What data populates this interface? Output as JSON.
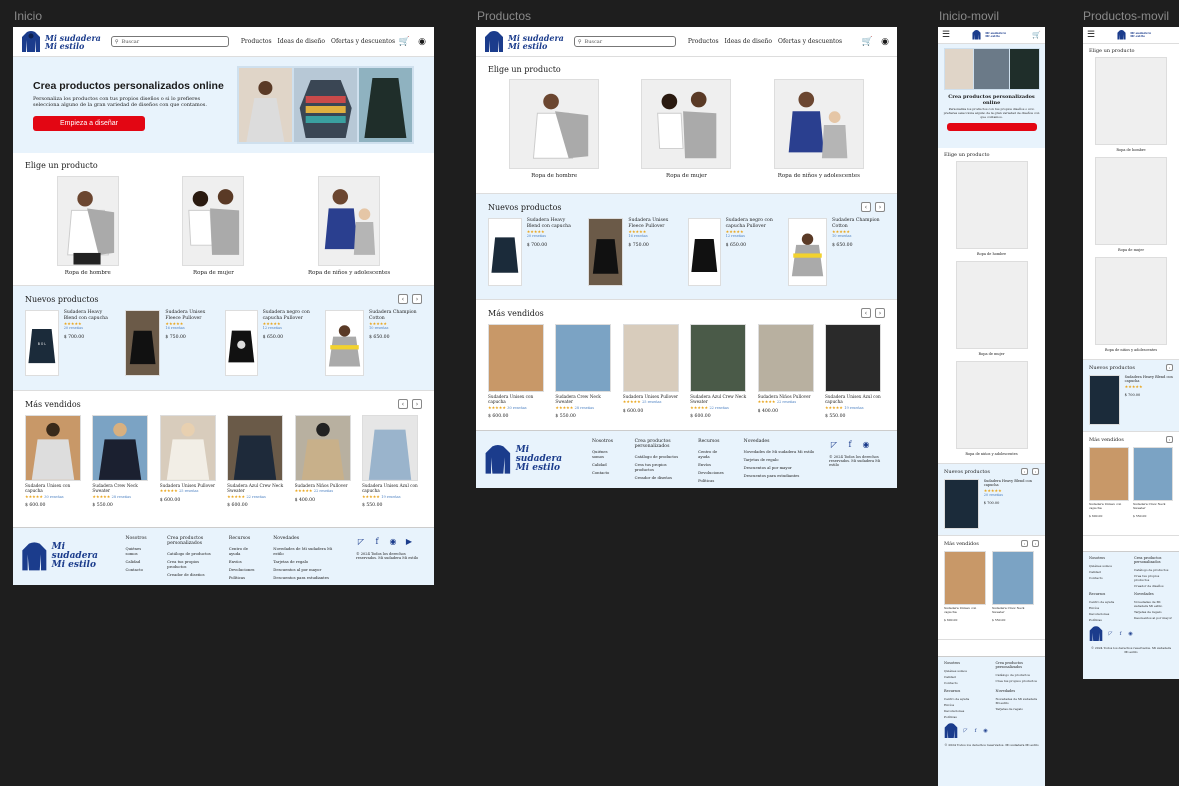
{
  "frames": {
    "inicio": "Inicio",
    "productos": "Productos",
    "inicio_movil": "Inicio-movil",
    "productos_movil": "Productos-movil"
  },
  "brand": {
    "line1": "Mi sudadera",
    "line2": "Mi estilo"
  },
  "search": {
    "placeholder": "Buscar"
  },
  "nav": [
    "Productos",
    "Ideas de diseño",
    "Ofertas y descuentos"
  ],
  "hero": {
    "title": "Crea productos personalizados online",
    "text": "Personaliza los productos con tus propios diseños o si lo prefieres selecciona alguno de la gran variedad de diseños con que contamos.",
    "button": "Empieza a diseñar"
  },
  "elige": {
    "title": "Elige un producto",
    "items": [
      "Ropa de hombre",
      "Ropa de mujer",
      "Ropa de niños y adolescentes"
    ]
  },
  "nuevos": {
    "title": "Nuevos productos",
    "items": [
      {
        "name": "Sudadera Heavy Blend con capucha",
        "reviews": "20 reseñas",
        "price": "$ 700.00"
      },
      {
        "name": "Sudadera Unisex Fleece Pullover",
        "reviews": "16 reseñas",
        "price": "$ 750.00"
      },
      {
        "name": "Sudadera negro con capucha Pullover",
        "reviews": "12 reseñas",
        "price": "$ 650.00"
      },
      {
        "name": "Sudadera Champion Cotton",
        "reviews": "10 reseñas",
        "price": "$ 650.00"
      }
    ]
  },
  "vendidos": {
    "title": "Más vendidos",
    "items": [
      {
        "name": "Sudadera Unisex con capucha",
        "reviews": "30 reseñas",
        "price": "$ 600.00"
      },
      {
        "name": "Sudadera Crew Neck Sweater",
        "reviews": "28 reseñas",
        "price": "$ 550.00"
      },
      {
        "name": "Sudadera Unisex Pullover",
        "reviews": "25 reseñas",
        "price": "$ 600.00"
      },
      {
        "name": "Sudadera Azul Crew Neck Sweater",
        "reviews": "22 reseñas",
        "price": "$ 600.00"
      },
      {
        "name": "Sudadera Niños Pullover",
        "reviews": "22 reseñas",
        "price": "$ 400.00"
      },
      {
        "name": "Sudadera Unisex Azul con capucha",
        "reviews": "19 reseñas",
        "price": "$ 550.00"
      }
    ]
  },
  "footer": {
    "col1": {
      "head": "Nosotros",
      "items": [
        "Quiénes somos",
        "Calidad",
        "Contacto"
      ]
    },
    "col2": {
      "head": "Crea productos personalizados",
      "items": [
        "Catálogo de productos",
        "Crea tus propios productos",
        "Creador de diseños"
      ]
    },
    "col3": {
      "head": "Recursos",
      "items": [
        "Centro de ayuda",
        "Envíos",
        "Devoluciones",
        "Políticas"
      ]
    },
    "col4": {
      "head": "Novedades",
      "items": [
        "Novedades de Mi sudadera Mi estilo",
        "Tarjetas de regalo",
        "Descuentos al por mayor",
        "Descuentos para estudiantes"
      ]
    },
    "copyright": "© 2024 Todos los derechos reservados. Mi sudadera Mi estilo"
  },
  "stars": "★★★★★",
  "colors": {
    "accent": "#1b3c8c",
    "cta": "#e30613",
    "light_bg": "#e8f3fc"
  }
}
